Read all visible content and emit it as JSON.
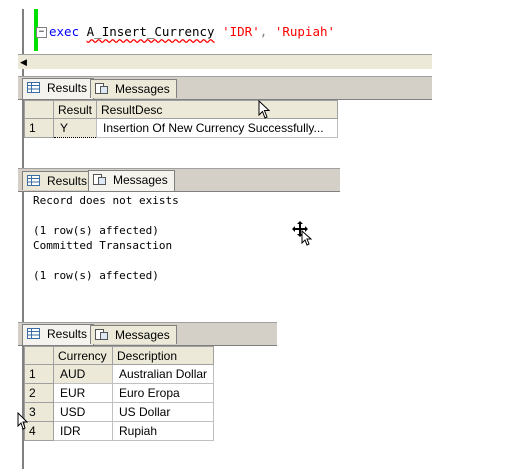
{
  "editor": {
    "code": {
      "keyword": "exec",
      "procedure": "A_Insert_Currency",
      "arg1": "'IDR'",
      "sep": ",",
      "arg2": "'Rupiah'"
    },
    "collapse_glyph": "−"
  },
  "tabs": {
    "results_label": "Results",
    "messages_label": "Messages"
  },
  "result1": {
    "columns": [
      "Result",
      "ResultDesc"
    ],
    "rows": [
      {
        "num": "1",
        "result": "Y",
        "desc": "Insertion Of New Currency Successfully..."
      }
    ]
  },
  "messages": {
    "lines": [
      "Record does not exists",
      "",
      "(1 row(s) affected)",
      "Committed Transaction",
      "",
      "(1 row(s) affected)"
    ]
  },
  "result2": {
    "columns": [
      "Currency",
      "Description"
    ],
    "rows": [
      {
        "num": "1",
        "currency": "AUD",
        "description": "Australian Dollar"
      },
      {
        "num": "2",
        "currency": "EUR",
        "description": "Euro Eropa"
      },
      {
        "num": "3",
        "currency": "USD",
        "description": "US Dollar"
      },
      {
        "num": "4",
        "currency": "IDR",
        "description": "Rupiah"
      }
    ]
  }
}
